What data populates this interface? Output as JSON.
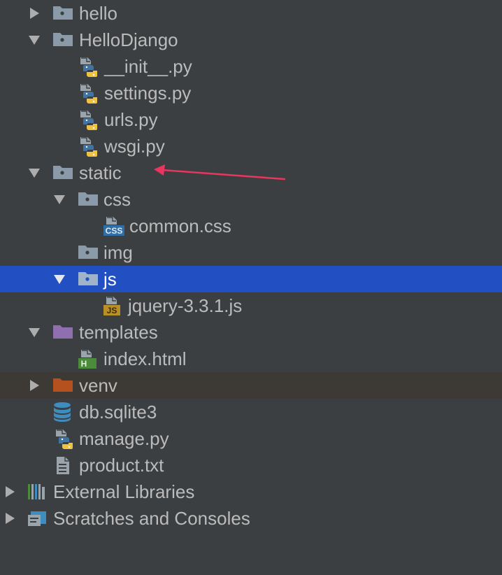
{
  "tree": {
    "hello": "hello",
    "hellodjango": "HelloDjango",
    "init_py": "__init__.py",
    "settings_py": "settings.py",
    "urls_py": "urls.py",
    "wsgi_py": "wsgi.py",
    "static": "static",
    "css": "css",
    "common_css": "common.css",
    "img": "img",
    "js": "js",
    "jquery": "jquery-3.3.1.js",
    "templates": "templates",
    "index_html": "index.html",
    "venv": "venv",
    "db": "db.sqlite3",
    "manage_py": "manage.py",
    "product_txt": "product.txt",
    "external_libraries": "External Libraries",
    "scratches": "Scratches and Consoles"
  },
  "badges": {
    "css": "CSS",
    "js": "JS",
    "html": "H"
  },
  "colors": {
    "background": "#3c3f41",
    "selection": "#2250c3",
    "excluded_row": "#3d3a36",
    "folder": "#8a9aa8",
    "templates_folder": "#8f6fb0",
    "excluded_folder": "#b5501f",
    "python_blue": "#3e74a6",
    "python_yellow": "#f0c23d",
    "annotation_arrow": "#e8365f"
  }
}
